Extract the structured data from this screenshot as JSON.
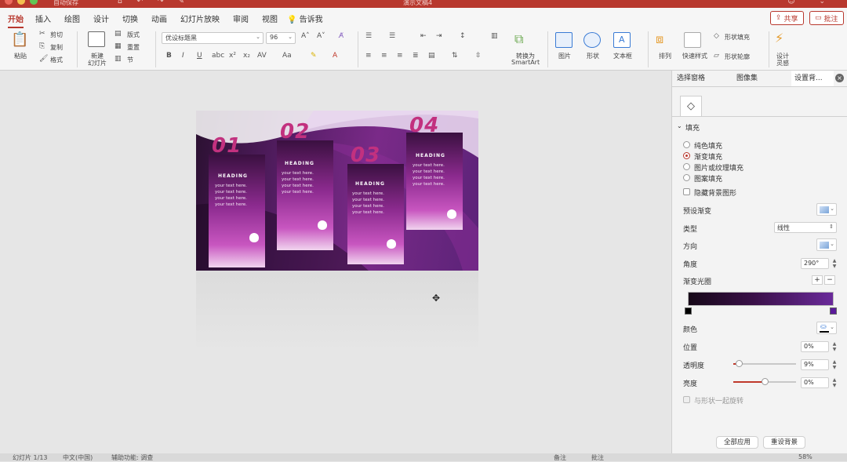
{
  "window": {
    "autosave_label": "自动保存",
    "doc_title": "演示文稿4",
    "brand_color": "#b8382e"
  },
  "tabs": [
    {
      "label": "开始",
      "active": true
    },
    {
      "label": "插入"
    },
    {
      "label": "绘图"
    },
    {
      "label": "设计"
    },
    {
      "label": "切换"
    },
    {
      "label": "动画"
    },
    {
      "label": "幻灯片放映"
    },
    {
      "label": "审阅"
    },
    {
      "label": "视图"
    }
  ],
  "tell_me": "告诉我",
  "share_label": "共享",
  "comment_label": "批注",
  "ribbon": {
    "paste": "粘贴",
    "cut": "剪切",
    "copy": "复制",
    "format": "格式",
    "new_slide_line1": "新建",
    "new_slide_line2": "幻灯片",
    "layout": "版式",
    "reset": "重置",
    "section": "节",
    "font_name": "优设标题黑",
    "font_size": "96",
    "convert_line1": "转换为",
    "convert_line2": "SmartArt",
    "picture": "图片",
    "shape": "形状",
    "textbox": "文本框",
    "arrange": "排列",
    "quick_styles": "快速样式",
    "shape_fill": "形状填充",
    "shape_outline": "形状轮廓",
    "designer_line1": "设计",
    "designer_line2": "灵感"
  },
  "slide": {
    "cards": [
      {
        "num": "01",
        "heading": "HEADING",
        "lines": [
          "your text here.",
          "your text here.",
          "your text here.",
          "your text here."
        ]
      },
      {
        "num": "02",
        "heading": "HEADING",
        "lines": [
          "your text here.",
          "your text here.",
          "your text here.",
          "your text here."
        ]
      },
      {
        "num": "03",
        "heading": "HEADING",
        "lines": [
          "your text here.",
          "your text here.",
          "your text here.",
          "your text here."
        ]
      },
      {
        "num": "04",
        "heading": "HEADING",
        "lines": [
          "your text here.",
          "your text here.",
          "your text here.",
          "your text here."
        ]
      }
    ]
  },
  "panel": {
    "tabs": [
      "选择窗格",
      "图像集",
      "设置背..."
    ],
    "section_title": "填充",
    "fill_options": [
      "纯色填充",
      "渐变填充",
      "图片或纹理填充",
      "图案填充"
    ],
    "selected_fill": "渐变填充",
    "hide_bg": "隐藏背景图形",
    "preset_gradient": "预设渐变",
    "type_label": "类型",
    "type_value": "线性",
    "direction_label": "方向",
    "angle_label": "角度",
    "angle_value": "290°",
    "gradient_stops": "渐变光圈",
    "color_label": "颜色",
    "position_label": "位置",
    "position_value": "0%",
    "transparency_label": "透明度",
    "transparency_value": "9%",
    "transparency_level": 0.09,
    "brightness_label": "亮度",
    "brightness_value": "0%",
    "brightness_level": 0.5,
    "rotate_with_shape": "与形状一起旋转",
    "apply_all": "全部应用",
    "reset_bg": "重设背景",
    "stop_colors": [
      "#000000",
      "#5a1a9a"
    ]
  },
  "status": {
    "slide_info": "幻灯片 1/13",
    "language": "中文(中国)",
    "accessibility": "辅助功能: 调查",
    "notes": "备注",
    "comments": "批注",
    "zoom": "58%"
  }
}
